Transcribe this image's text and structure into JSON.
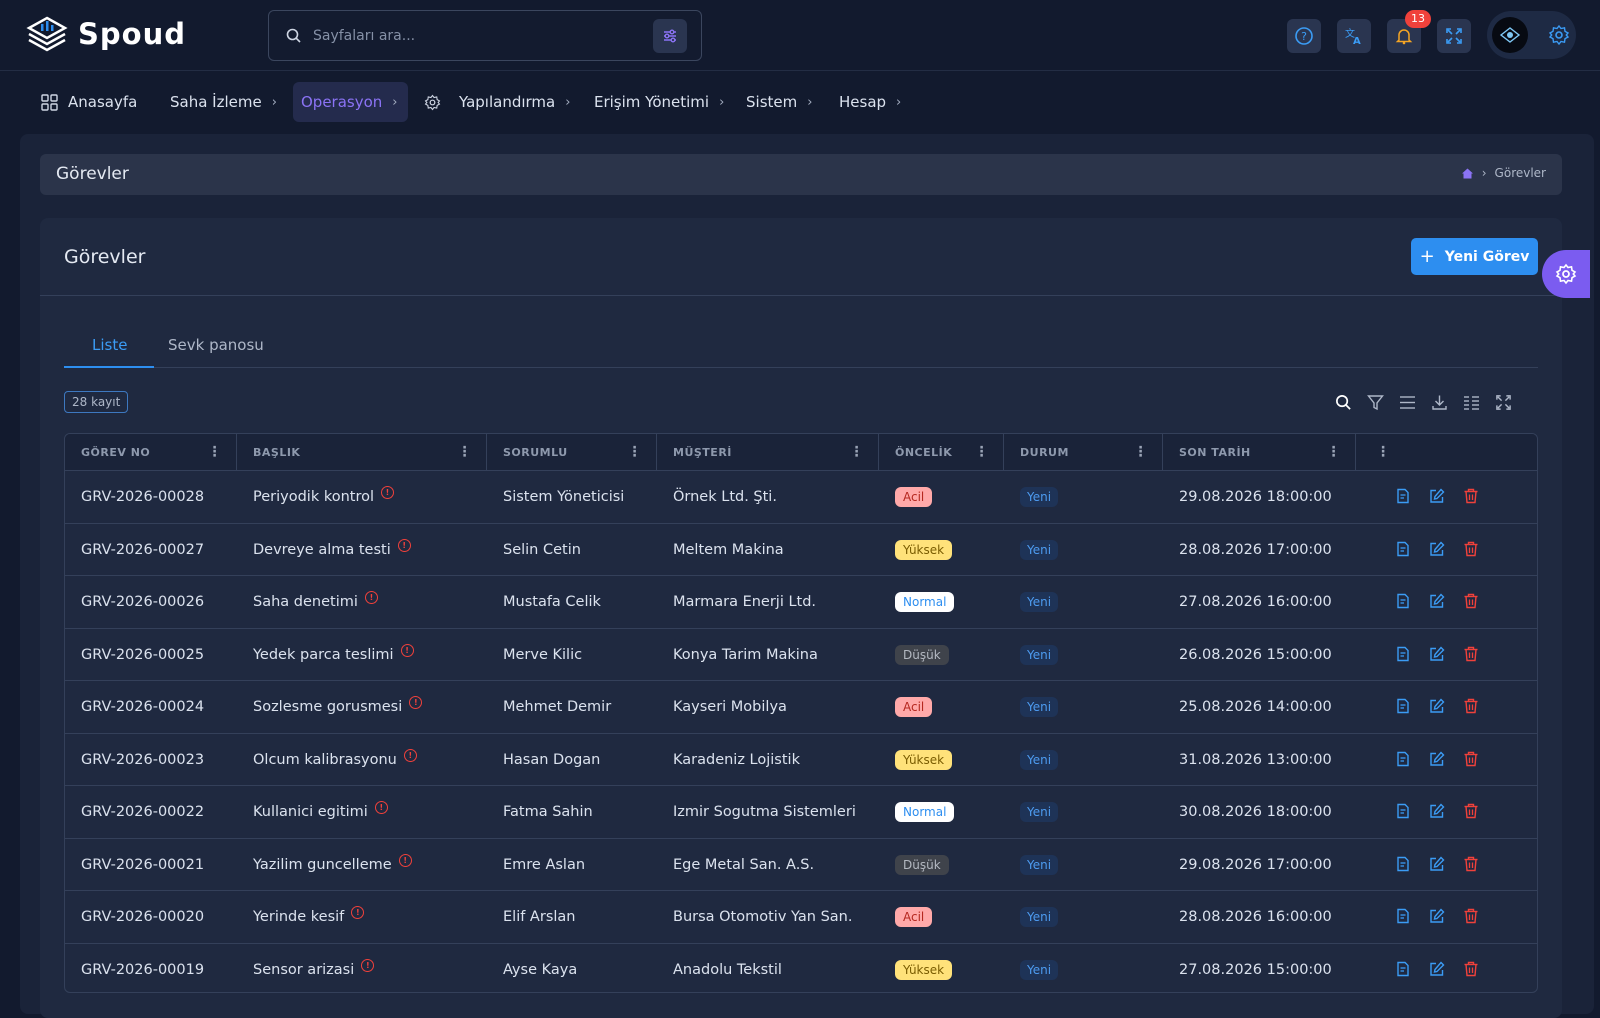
{
  "app": {
    "name": "Spoud"
  },
  "search": {
    "placeholder": "Sayfaları ara..."
  },
  "notifications": {
    "count": "13"
  },
  "nav": [
    {
      "label": "Anasayfa",
      "icon": "grid-icon"
    },
    {
      "label": "Saha İzleme"
    },
    {
      "label": "Operasyon",
      "active": true
    },
    {
      "label": "Yapılandırma",
      "icon": "gear-icon"
    },
    {
      "label": "Erişim Yönetimi"
    },
    {
      "label": "Sistem"
    },
    {
      "label": "Hesap"
    }
  ],
  "page": {
    "title": "Görevler",
    "breadcrumb_current": "Görevler"
  },
  "card": {
    "title": "Görevler",
    "new_button": "Yeni Görev"
  },
  "tabs": [
    {
      "label": "Liste",
      "active": true
    },
    {
      "label": "Sevk panosu"
    }
  ],
  "records": {
    "count_label": "28 kayıt"
  },
  "table": {
    "columns": [
      "GÖREV NO",
      "BAŞLIK",
      "SORUMLU",
      "MÜŞTERİ",
      "ÖNCELİK",
      "DURUM",
      "SON TARİH",
      ""
    ],
    "rows": [
      {
        "no": "GRV-2026-00028",
        "title": "Periyodik kontrol",
        "owner": "Sistem Yöneticisi",
        "customer": "Örnek Ltd. Şti.",
        "priority": "Acil",
        "pclass": "acil",
        "status": "Yeni",
        "due": "29.08.2026 18:00:00"
      },
      {
        "no": "GRV-2026-00027",
        "title": "Devreye alma testi",
        "owner": "Selin Cetin",
        "customer": "Meltem Makina",
        "priority": "Yüksek",
        "pclass": "yuksek",
        "status": "Yeni",
        "due": "28.08.2026 17:00:00"
      },
      {
        "no": "GRV-2026-00026",
        "title": "Saha denetimi",
        "owner": "Mustafa Celik",
        "customer": "Marmara Enerji Ltd.",
        "priority": "Normal",
        "pclass": "normal",
        "status": "Yeni",
        "due": "27.08.2026 16:00:00"
      },
      {
        "no": "GRV-2026-00025",
        "title": "Yedek parca teslimi",
        "owner": "Merve Kilic",
        "customer": "Konya Tarim Makina",
        "priority": "Düşük",
        "pclass": "dusuk",
        "status": "Yeni",
        "due": "26.08.2026 15:00:00"
      },
      {
        "no": "GRV-2026-00024",
        "title": "Sozlesme gorusmesi",
        "owner": "Mehmet Demir",
        "customer": "Kayseri Mobilya",
        "priority": "Acil",
        "pclass": "acil",
        "status": "Yeni",
        "due": "25.08.2026 14:00:00"
      },
      {
        "no": "GRV-2026-00023",
        "title": "Olcum kalibrasyonu",
        "owner": "Hasan Dogan",
        "customer": "Karadeniz Lojistik",
        "priority": "Yüksek",
        "pclass": "yuksek",
        "status": "Yeni",
        "due": "31.08.2026 13:00:00"
      },
      {
        "no": "GRV-2026-00022",
        "title": "Kullanici egitimi",
        "owner": "Fatma Sahin",
        "customer": "Izmir Sogutma Sistemleri",
        "priority": "Normal",
        "pclass": "normal",
        "status": "Yeni",
        "due": "30.08.2026 18:00:00"
      },
      {
        "no": "GRV-2026-00021",
        "title": "Yazilim guncelleme",
        "owner": "Emre Aslan",
        "customer": "Ege Metal San. A.S.",
        "priority": "Düşük",
        "pclass": "dusuk",
        "status": "Yeni",
        "due": "29.08.2026 17:00:00"
      },
      {
        "no": "GRV-2026-00020",
        "title": "Yerinde kesif",
        "owner": "Elif Arslan",
        "customer": "Bursa Otomotiv Yan San.",
        "priority": "Acil",
        "pclass": "acil",
        "status": "Yeni",
        "due": "28.08.2026 16:00:00"
      },
      {
        "no": "GRV-2026-00019",
        "title": "Sensor arizasi",
        "owner": "Ayse Kaya",
        "customer": "Anadolu Tekstil",
        "priority": "Yüksek",
        "pclass": "yuksek",
        "status": "Yeni",
        "due": "27.08.2026 15:00:00"
      }
    ]
  },
  "colors": {
    "accent": "#2d8ef0",
    "purple": "#7b5cf0",
    "danger": "#f0413b",
    "background": "#121a2e"
  }
}
